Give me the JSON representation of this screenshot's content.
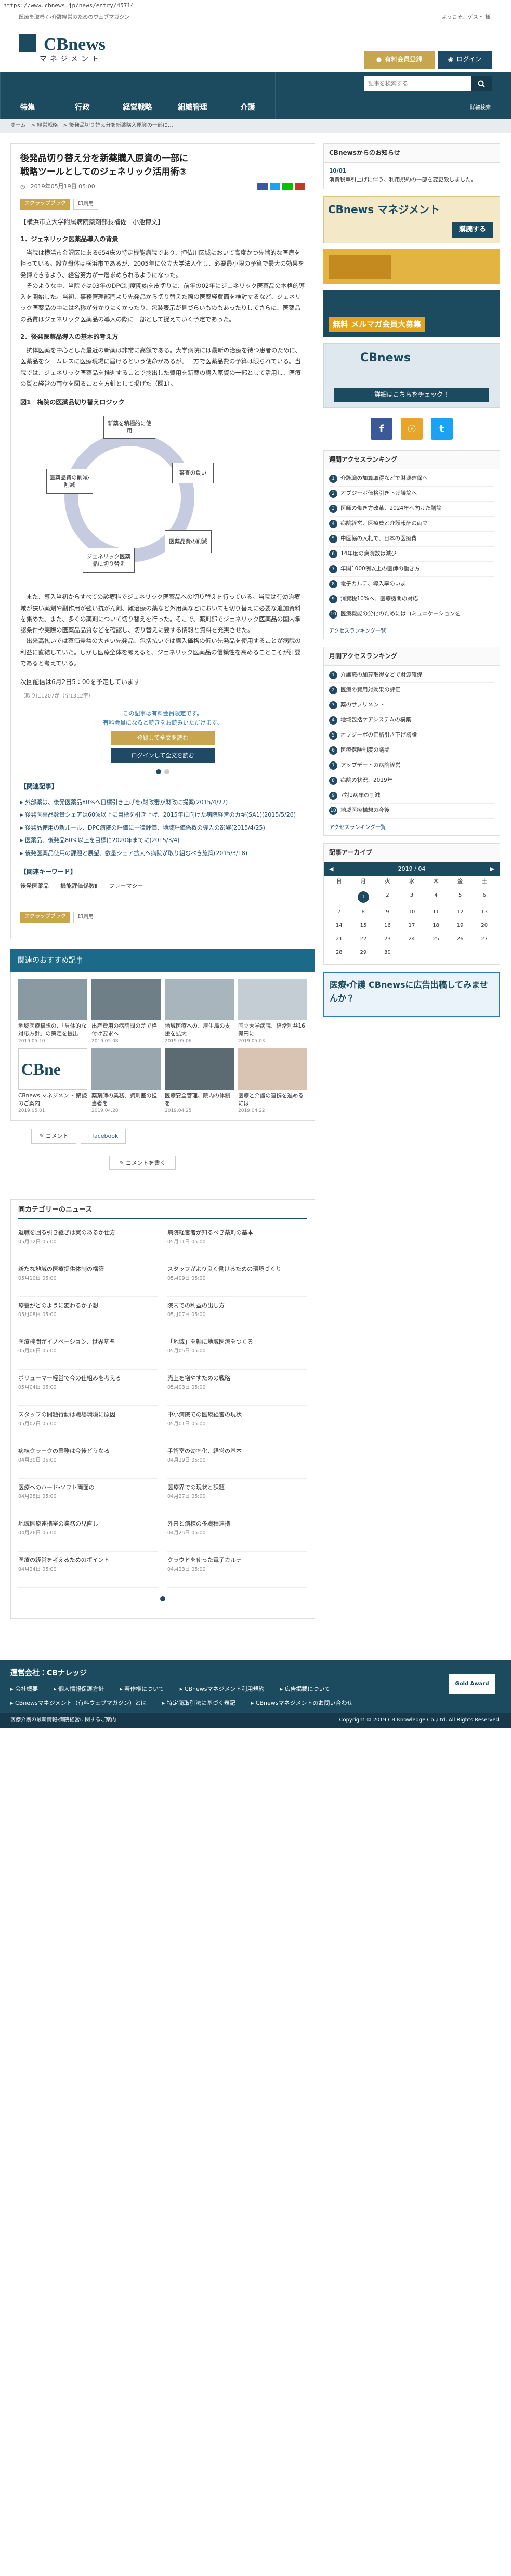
{
  "url": "https://www.cbnews.jp/news/entry/45714",
  "header": {
    "tagline": "医療を取巻く・介護経営のためのウェブマガジン",
    "welcome": "ようこそ、ゲスト 様",
    "logo_text": "CBnews",
    "logo_sub": "マネジメント",
    "trial_label": "有料会員登録",
    "login_label": "ログイン"
  },
  "nav": {
    "items": [
      "特集",
      "行政",
      "経営戦略",
      "組織管理",
      "介護"
    ],
    "search_placeholder": "記事を検索する",
    "detail_search": "詳細検索"
  },
  "breadcrumb": [
    "ホーム",
    "経営戦略",
    "後発品切り替え分を新薬購入原資の一部に…"
  ],
  "article": {
    "title": "後発品切り替え分を新薬購入原資の一部に\n戦略ツールとしてのジェネリック活用術③",
    "date": "2019年05月19日 05:00",
    "scrap_label": "スクラップブック",
    "print_label": "印刷用",
    "author": "【横浜市立大学附属病院薬剤部長補佐　小池博文】",
    "sec1_h": "1．ジェネリック医薬品導入の背景",
    "sec1_p1": "当院は横浜市金沢区にある654床の特定機能病院であり、押仏川区域において高度かつ先端的な医療を担っている。設立母体は横浜市であるが、2005年に公立大学法人化し、必要最小限の予算で最大の効果を発揮できるよう、経営努力が一層求められるようになった。",
    "sec1_p2": "そのような中、当院では03年のDPC制度開始を皮切りに、前年の02年にジェネリック医薬品の本格的導入を開始した。当初、事務管理部門より先発品から切り替えた際の医薬経費面を検討するなど、ジェネリック医薬品の中には名称が分かりにくかったり、包装表示が見づらいものもあったりしてさらに、医薬品の品質はジェネリック医薬品の導入の際に一部として捉えていく予定であった。",
    "sec2_h": "2．後発医薬品導入の基本的考え方",
    "sec2_p1": "抗体医薬を中心とした最近の新薬は非常に高額である。大学病院には最新の治療を待つ患者のために、医薬品をシームレスに医療現場に届けるという使命があるが、一方で医薬品費の予算は限られている。当院では、ジェネリック医薬品を推進することで捻出した費用を新薬の購入原資の一部として活用し、医療の質と経営の両立を図ることを方針として掲げた（図1）。",
    "fig_title": "図1　梅院の医薬品切り替えロジック",
    "fig_nodes": [
      "新薬を積極的に使用",
      "審査の負い",
      "医薬品費の削減",
      "ジェネリック医薬品に切り替え",
      "医薬品費の削減・削減"
    ],
    "sec2_p2": "また、導入当初からすべての診療科でジェネリック医薬品への切り替えを行っている。当院は有効治療域が狭い薬剤や副作用が強い抗がん剤、難治療の薬など外用薬などにおいても切り替えに必要な追加資料を集めた。また、多くの薬剤について切り替えを行った。そこで、薬剤部でジェネリック医薬品の国内承認条件や実際の医薬品品質などを確認し、切り替えに要する情報と資料を充実させた。",
    "sec2_p3": "出来高払いでは薬価差益の大きい先発品、包括払いでは購入価格の低い先発品を使用することが病院の利益に直結していた。しかし医療全体を考えると、ジェネリック医薬品の信頼性を高めることこそが肝要であると考えている。",
    "next": "次回配信は6月2日5：00を予定しています",
    "credit": "（取りに1207が（全1312字）",
    "paywall_note": "この記事は有料会員限定です。",
    "paywall_note2": "有料会員になると続きをお読みいただけます。",
    "register_btn": "登録して全文を読む",
    "login_btn": "ログインして全文を読む",
    "related_h": "【関連記事】",
    "related": [
      "外部薬は、後発医薬品80%へ目標引き上げを・財政審が財政に提案(2015/4/27)",
      "後発医薬品数量シェアは60%以上に目標を引き上げ、2015年に向けた病院経営のカギ(SA1)(2015/5/26)",
      "後発品使用の新ルール、DPC病院の評価に一律評価、地域評価係数の導入の影響(2015/4/25)",
      "医薬品、後発品80%以上を目標に2020年までに(2015/3/4)",
      "後発医薬品使用の課題と展望、数量シェア拡大へ病院が取り組むべき施策(2015/3/18)"
    ],
    "kw_h": "【関連キーワード】",
    "keywords": [
      "後発医薬品",
      "機能評価係数Ⅱ",
      "ファーマシー"
    ]
  },
  "recommend": {
    "heading": "関連のおすすめ記事",
    "cards": [
      {
        "text": "地域医療構想の、「具体的な対応方針」の策定を提出",
        "date": "2019.05.10"
      },
      {
        "text": "出産費用の病院間の差で格付け要求へ",
        "date": "2019.05.08"
      },
      {
        "text": "地域医療への、厚生局の支援を拡大",
        "date": "2019.05.06"
      },
      {
        "text": "国立大学病院、経常利益16億円に",
        "date": "2019.05.03"
      },
      {
        "text": "CBnews マネジメント 購読のご案内",
        "date": "2019.05.01"
      },
      {
        "text": "薬剤師の業務、調剤室の担当者を",
        "date": "2019.04.28"
      },
      {
        "text": "医療安全管理、院内の体制を",
        "date": "2019.04.25"
      },
      {
        "text": "医療と介護の連携を進めるには",
        "date": "2019.04.22"
      }
    ],
    "comment_btn": "コメント",
    "fb_btn": "facebook",
    "comment_add": "コメントを書く"
  },
  "samecat": {
    "heading": "同カテゴリーのニュース",
    "items": [
      {
        "text": "退職を回る引き継ぎは実のあるか仕方",
        "date": "05月12日 05:00"
      },
      {
        "text": "病院経営者が知るべき薬剤の基本",
        "date": "05月11日 05:00"
      },
      {
        "text": "新たな地域の医療提供体制の構築",
        "date": "05月10日 05:00"
      },
      {
        "text": "スタッフがより良く働けるための環境づくり",
        "date": "05月09日 05:00"
      },
      {
        "text": "療養がどのように変わるか予想",
        "date": "05月08日 05:00"
      },
      {
        "text": "院内での利益の出し方",
        "date": "05月07日 05:00"
      },
      {
        "text": "医療機関がイノベーション、世界基準",
        "date": "05月06日 05:00"
      },
      {
        "text": "「地域」を軸に地域医療をつくる",
        "date": "05月05日 05:00"
      },
      {
        "text": "ボリューマー経営で今の仕組みを考える",
        "date": "05月04日 05:00"
      },
      {
        "text": "売上を増やすための戦略",
        "date": "05月03日 05:00"
      },
      {
        "text": "スタッフの問題行動は職場環境に原因",
        "date": "05月02日 05:00"
      },
      {
        "text": "中小病院での医療経営の現状",
        "date": "05月01日 05:00"
      },
      {
        "text": "病棟クラークの業務は今後どうなる",
        "date": "04月30日 05:00"
      },
      {
        "text": "手術室の効率化、経営の基本",
        "date": "04月29日 05:00"
      },
      {
        "text": "医療へのハード・ソフト両面の",
        "date": "04月28日 05:00"
      },
      {
        "text": "医療界での現状と課題",
        "date": "04月27日 05:00"
      },
      {
        "text": "地域医療連携室の業務の見直し",
        "date": "04月26日 05:00"
      },
      {
        "text": "外来と病棟の多職種連携",
        "date": "04月25日 05:00"
      },
      {
        "text": "医療の経営を考えるためのポイント",
        "date": "04月24日 05:00"
      },
      {
        "text": "クラウドを使った電子カルテ",
        "date": "04月23日 05:00"
      }
    ]
  },
  "side": {
    "notice_h": "CBnewsからのお知らせ",
    "notice_date": "10/01",
    "notice_text": "消費税率引上げに伴う、利用規約の一部を変更致しました。",
    "banner1_title": "CBnews マネジメント",
    "banner1_sub": "購読する",
    "banner2_title": "無料 メルマガ会員大募集",
    "banner3_title": "CBnews",
    "banner3_sub": "詳細はこちらをチェック！",
    "weekly_h": "週間アクセスランキング",
    "weekly": [
      "介護職の加算取得などで財源確保へ",
      "オプジーボ価格引き下げ議論へ",
      "医師の働き方改革、2024年へ向けた議論",
      "病院経営、医療費と介護報酬の両立",
      "中医協の入札で、日本の医療費",
      "14年度の病院数は減少",
      "年間1000例以上の医師の働き方",
      "電子カルテ、導入率のいま",
      "消費税10%へ、医療機関の対応",
      "医療機能の分化のためにはコミュニケーションを"
    ],
    "weekly_more": "アクセスランキング一覧",
    "monthly_h": "月間アクセスランキング",
    "monthly": [
      "介護職の加算取得などで財源確保",
      "医療の費用対効果の評価",
      "薬のサプリメント",
      "地域包括ケアシステムの構築",
      "オプジーボの価格引き下げ議論",
      "医療保険制度の議論",
      "アップデートの病院経営",
      "病院の状況、2019年",
      "7対1病床の削減",
      "地域医療構想の今後"
    ],
    "monthly_more": "アクセスランキング一覧",
    "archive_h": "記事アーカイブ",
    "cal_month": "2019 / 04",
    "cal_dh": [
      "日",
      "月",
      "火",
      "水",
      "木",
      "金",
      "土"
    ],
    "cal_days": [
      "",
      "1",
      "2",
      "3",
      "4",
      "5",
      "6",
      "7",
      "8",
      "9",
      "10",
      "11",
      "12",
      "13",
      "14",
      "15",
      "16",
      "17",
      "18",
      "19",
      "20",
      "21",
      "22",
      "23",
      "24",
      "25",
      "26",
      "27",
      "28",
      "29",
      "30",
      "",
      "",
      "",
      ""
    ],
    "ad_text": "医療・介護 CBnewsに広告出稿してみませんか？"
  },
  "footer": {
    "company": "運営会社：CBナレッジ",
    "links": [
      "会社概要",
      "個人情報保護方針",
      "著作権について",
      "CBnewsマネジメント利用規約",
      "広告掲載について",
      "CBnewsマネジメント（有料ウェブマガジン）とは",
      "特定商取引法に基づく表記",
      "CBnewsマネジメントのお問い合わせ"
    ],
    "gold_logo": "Gold Award",
    "bottom_left": "医療介護の最新情報・病院経営に関するご案内",
    "copyright": "Copyright © 2019 CB Knowledge Co.,Ltd. All Rights Reserved."
  }
}
